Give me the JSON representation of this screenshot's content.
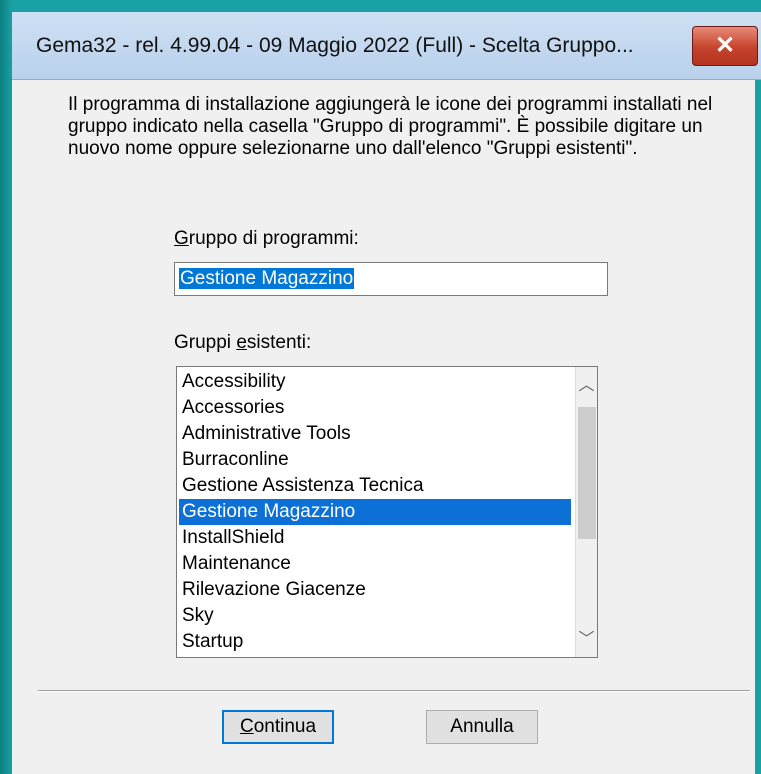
{
  "window": {
    "title": "Gema32 - rel. 4.99.04 - 09 Maggio 2022 (Full) - Scelta Gruppo...",
    "close_glyph": "✕"
  },
  "description": "Il programma di installazione aggiungerà le icone dei programmi installati nel gruppo indicato nella casella \"Gruppo di programmi\". È possibile digitare un nuovo nome oppure selezionarne uno dall'elenco \"Gruppi esistenti\".",
  "group_field": {
    "label_accel": "G",
    "label_rest": "ruppo di programmi:",
    "value": "Gestione Magazzino"
  },
  "existing": {
    "label_pre": "Gruppi ",
    "label_accel": "e",
    "label_rest": "sistenti:",
    "items": [
      "Accessibility",
      "Accessories",
      "Administrative Tools",
      "Burraconline",
      "Gestione Assistenza Tecnica",
      "Gestione Magazzino",
      "InstallShield",
      "Maintenance",
      "Rilevazione Giacenze",
      "Sky",
      "Startup"
    ],
    "selected_index": 5
  },
  "buttons": {
    "continue_accel": "C",
    "continue_rest": "ontinua",
    "cancel": "Annulla"
  },
  "icons": {
    "scroll_up": "chevron-up-icon",
    "scroll_down": "chevron-down-icon"
  }
}
